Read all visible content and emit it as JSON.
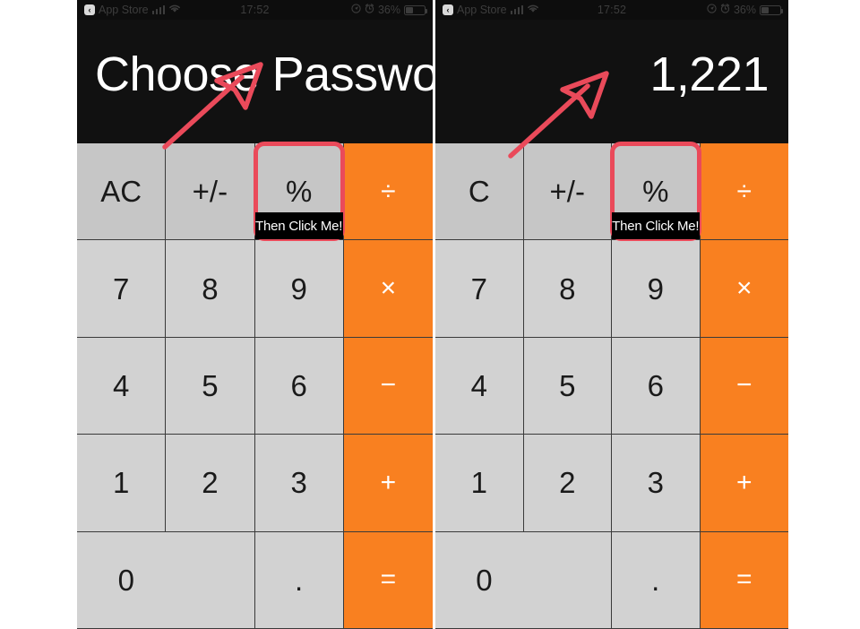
{
  "layout": {
    "panel_count": 2,
    "background": "#ffffff",
    "phone_screen_bg": "#111111",
    "key_bg": "#d2d2d2",
    "key_fn_bg": "#c6c6c6",
    "key_op_bg": "#f98020",
    "highlight_color": "#ea4a5a",
    "tooltip_bg": "#000000"
  },
  "panels": [
    {
      "id": "left",
      "statusbar": {
        "app_badge": "‹",
        "app_label": "App Store",
        "signal_icon": "cellular-signal-icon",
        "wifi_icon": "wifi-icon",
        "time": "17:52",
        "location_icon": "location-arrow-icon",
        "alarm_icon": "alarm-clock-icon",
        "battery_percent": "36%",
        "battery_icon": "battery-icon"
      },
      "display": {
        "value": "Choose Password",
        "align": "left"
      },
      "keys": [
        {
          "label": "AC",
          "type": "fn"
        },
        {
          "label": "+/-",
          "type": "fn"
        },
        {
          "label": "%",
          "type": "fn",
          "highlighted": true,
          "tooltip": "Then Click Me!"
        },
        {
          "label": "÷",
          "type": "op"
        },
        {
          "label": "7",
          "type": "num"
        },
        {
          "label": "8",
          "type": "num"
        },
        {
          "label": "9",
          "type": "num"
        },
        {
          "label": "×",
          "type": "op"
        },
        {
          "label": "4",
          "type": "num"
        },
        {
          "label": "5",
          "type": "num"
        },
        {
          "label": "6",
          "type": "num"
        },
        {
          "label": "−",
          "type": "op"
        },
        {
          "label": "1",
          "type": "num"
        },
        {
          "label": "2",
          "type": "num"
        },
        {
          "label": "3",
          "type": "num"
        },
        {
          "label": "+",
          "type": "op"
        },
        {
          "label": "0",
          "type": "zero"
        },
        {
          "label": ".",
          "type": "dot"
        },
        {
          "label": "=",
          "type": "op"
        }
      ],
      "annotation": {
        "arrow_icon": "red-arrow-up-right-icon",
        "arrow_color": "#ea4a5a",
        "points_to": "percent-key"
      }
    },
    {
      "id": "right",
      "statusbar": {
        "app_badge": "‹",
        "app_label": "App Store",
        "signal_icon": "cellular-signal-icon",
        "wifi_icon": "wifi-icon",
        "time": "17:52",
        "location_icon": "location-arrow-icon",
        "alarm_icon": "alarm-clock-icon",
        "battery_percent": "36%",
        "battery_icon": "battery-icon"
      },
      "display": {
        "value": "1,221",
        "align": "right"
      },
      "keys": [
        {
          "label": "C",
          "type": "fn"
        },
        {
          "label": "+/-",
          "type": "fn"
        },
        {
          "label": "%",
          "type": "fn",
          "highlighted": true,
          "tooltip": "Then Click Me!"
        },
        {
          "label": "÷",
          "type": "op"
        },
        {
          "label": "7",
          "type": "num"
        },
        {
          "label": "8",
          "type": "num"
        },
        {
          "label": "9",
          "type": "num"
        },
        {
          "label": "×",
          "type": "op"
        },
        {
          "label": "4",
          "type": "num"
        },
        {
          "label": "5",
          "type": "num"
        },
        {
          "label": "6",
          "type": "num"
        },
        {
          "label": "−",
          "type": "op"
        },
        {
          "label": "1",
          "type": "num"
        },
        {
          "label": "2",
          "type": "num"
        },
        {
          "label": "3",
          "type": "num"
        },
        {
          "label": "+",
          "type": "op"
        },
        {
          "label": "0",
          "type": "zero"
        },
        {
          "label": ".",
          "type": "dot"
        },
        {
          "label": "=",
          "type": "op"
        }
      ],
      "annotation": {
        "arrow_icon": "red-arrow-up-right-icon",
        "arrow_color": "#ea4a5a",
        "points_to": "percent-key"
      }
    }
  ]
}
